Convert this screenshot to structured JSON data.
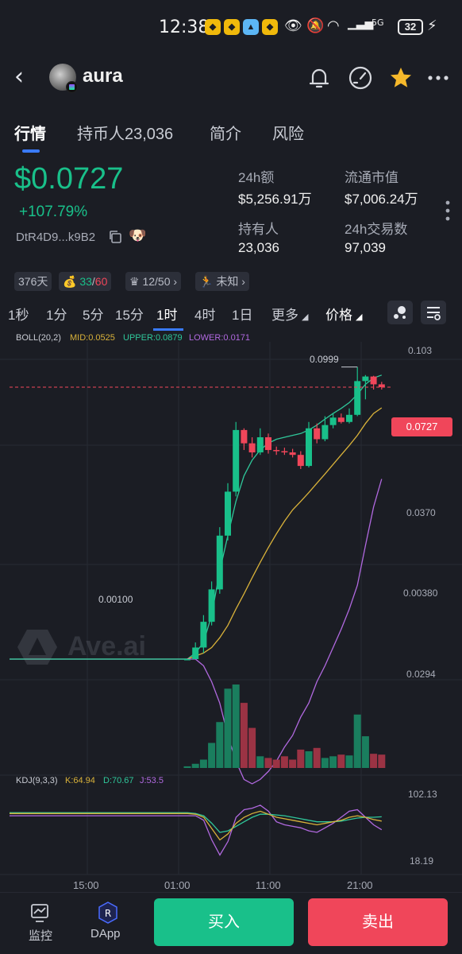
{
  "status_bar": {
    "time": "12:38",
    "signal_label": "5G",
    "battery": "32"
  },
  "header": {
    "token_name": "aura"
  },
  "tabs": [
    {
      "label": "行情"
    },
    {
      "label": "持币人23,036"
    },
    {
      "label": "简介"
    },
    {
      "label": "风险"
    }
  ],
  "summary": {
    "price": "$0.0727",
    "change": "+107.79%",
    "address": "DtR4D9...k9B2",
    "stats": {
      "vol_label": "24h额",
      "vol_value": "$5,256.91万",
      "mcap_label": "流通市值",
      "mcap_value": "$7,006.24万",
      "holders_label": "持有人",
      "holders_value": "23,036",
      "txs_label": "24h交易数",
      "txs_value": "97,039"
    }
  },
  "pills": {
    "age": "376天",
    "score_a": "33",
    "score_sep": "/",
    "score_b": "60",
    "rank": "12/50",
    "status": "未知"
  },
  "timeframes": [
    "1秒",
    "1分",
    "5分",
    "15分",
    "1时",
    "4时",
    "1日"
  ],
  "timeframe_active": "1时",
  "more_label": "更多",
  "price_label": "价格",
  "chart_legend": {
    "boll": "BOLL(20,2)",
    "mid": "MID:0.0525",
    "upper": "UPPER:0.0879",
    "lower": "LOWER:0.0171"
  },
  "kdj_legend": {
    "name": "KDJ(9,3,3)",
    "k": "K:64.94",
    "d": "D:70.67",
    "j": "J:53.5"
  },
  "colors": {
    "up": "#19c08a",
    "down": "#f0465a",
    "accent": "#3a7bff",
    "mid": "#d9b23a",
    "upper": "#2fc79a",
    "lower": "#b169e0"
  },
  "watermark": "Ave.ai",
  "chart_data": {
    "type": "line",
    "y_axis_labels": [
      "0.103",
      "0.0370",
      "0.00380",
      "0.0294"
    ],
    "high_annotation": "0.0999",
    "low_annotation": "0.00100",
    "current_price": "0.0727",
    "x_axis_labels": [
      "15:00",
      "01:00",
      "11:00",
      "21:00"
    ],
    "kdj_axis_labels": [
      "102.13",
      "18.19"
    ],
    "candles": [
      {
        "o": 0.001,
        "c": 0.001,
        "h": 0.001,
        "l": 0.001
      },
      {
        "o": 0.001,
        "c": 0.0012,
        "h": 0.0013,
        "l": 0.001
      },
      {
        "o": 0.0012,
        "c": 0.0018,
        "h": 0.002,
        "l": 0.0011
      },
      {
        "o": 0.0018,
        "c": 0.003,
        "h": 0.0034,
        "l": 0.0017
      },
      {
        "o": 0.003,
        "c": 0.007,
        "h": 0.008,
        "l": 0.0028
      },
      {
        "o": 0.007,
        "c": 0.014,
        "h": 0.016,
        "l": 0.0065
      },
      {
        "o": 0.014,
        "c": 0.037,
        "h": 0.042,
        "l": 0.013
      },
      {
        "o": 0.037,
        "c": 0.03,
        "h": 0.038,
        "l": 0.027
      },
      {
        "o": 0.03,
        "c": 0.026,
        "h": 0.033,
        "l": 0.024
      },
      {
        "o": 0.026,
        "c": 0.033,
        "h": 0.038,
        "l": 0.025
      },
      {
        "o": 0.033,
        "c": 0.027,
        "h": 0.035,
        "l": 0.0255
      },
      {
        "o": 0.027,
        "c": 0.0265,
        "h": 0.0285,
        "l": 0.025
      },
      {
        "o": 0.0265,
        "c": 0.026,
        "h": 0.028,
        "l": 0.025
      },
      {
        "o": 0.026,
        "c": 0.025,
        "h": 0.0275,
        "l": 0.024
      },
      {
        "o": 0.025,
        "c": 0.021,
        "h": 0.0265,
        "l": 0.02
      },
      {
        "o": 0.021,
        "c": 0.038,
        "h": 0.042,
        "l": 0.0205
      },
      {
        "o": 0.038,
        "c": 0.032,
        "h": 0.041,
        "l": 0.03
      },
      {
        "o": 0.032,
        "c": 0.04,
        "h": 0.046,
        "l": 0.031
      },
      {
        "o": 0.04,
        "c": 0.045,
        "h": 0.048,
        "l": 0.038
      },
      {
        "o": 0.045,
        "c": 0.042,
        "h": 0.048,
        "l": 0.041
      },
      {
        "o": 0.042,
        "c": 0.047,
        "h": 0.052,
        "l": 0.041
      },
      {
        "o": 0.047,
        "c": 0.08,
        "h": 0.0999,
        "l": 0.046
      },
      {
        "o": 0.08,
        "c": 0.086,
        "h": 0.088,
        "l": 0.06
      },
      {
        "o": 0.086,
        "c": 0.076,
        "h": 0.087,
        "l": 0.07
      },
      {
        "o": 0.076,
        "c": 0.0727,
        "h": 0.079,
        "l": 0.07
      }
    ],
    "boll_mid": [
      0.001,
      0.00105,
      0.0011,
      0.0012,
      0.0014,
      0.0017,
      0.0022,
      0.0028,
      0.0036,
      0.0046,
      0.0058,
      0.0072,
      0.0088,
      0.0105,
      0.012,
      0.0138,
      0.016,
      0.0185,
      0.0215,
      0.025,
      0.029,
      0.034,
      0.041,
      0.048,
      0.0525
    ],
    "boll_upper": [
      0.001,
      0.0011,
      0.0013,
      0.002,
      0.004,
      0.007,
      0.012,
      0.018,
      0.023,
      0.027,
      0.03,
      0.032,
      0.033,
      0.034,
      0.035,
      0.037,
      0.04,
      0.044,
      0.048,
      0.052,
      0.057,
      0.065,
      0.076,
      0.084,
      0.0879
    ],
    "boll_lower": [
      0.001,
      0.001,
      0.0009,
      0.0007,
      0.0005,
      0.0003,
      0.0002,
      0.00015,
      0.00014,
      0.00015,
      0.00017,
      0.0002,
      0.00025,
      0.0003,
      0.0004,
      0.0005,
      0.0007,
      0.0009,
      0.0012,
      0.0016,
      0.0022,
      0.0032,
      0.006,
      0.011,
      0.0171
    ],
    "volume": [
      0.02,
      0.05,
      0.1,
      0.3,
      0.55,
      0.95,
      1.0,
      0.78,
      0.48,
      0.14,
      0.12,
      0.1,
      0.14,
      0.1,
      0.22,
      0.2,
      0.24,
      0.12,
      0.14,
      0.16,
      0.15,
      0.64,
      0.38,
      0.17,
      0.16
    ],
    "kdj_k": [
      75,
      74,
      70,
      55,
      40,
      48,
      62,
      70,
      75,
      78,
      74,
      70,
      68,
      66,
      64,
      62,
      60,
      62,
      64,
      66,
      70,
      72,
      70,
      67,
      64.94
    ],
    "kdj_d": [
      76,
      75,
      72,
      62,
      50,
      52,
      58,
      64,
      70,
      74,
      74,
      73,
      72,
      70,
      68,
      66,
      64,
      64,
      64,
      65,
      67,
      69,
      70,
      70,
      70.67
    ],
    "kdj_j": [
      72,
      72,
      66,
      40,
      20,
      38,
      70,
      80,
      82,
      86,
      78,
      64,
      60,
      58,
      56,
      52,
      50,
      56,
      62,
      70,
      78,
      80,
      70,
      60,
      53.5
    ]
  },
  "bottom_nav": {
    "monitor": "监控",
    "dapp": "DApp",
    "buy": "买入",
    "sell": "卖出"
  }
}
